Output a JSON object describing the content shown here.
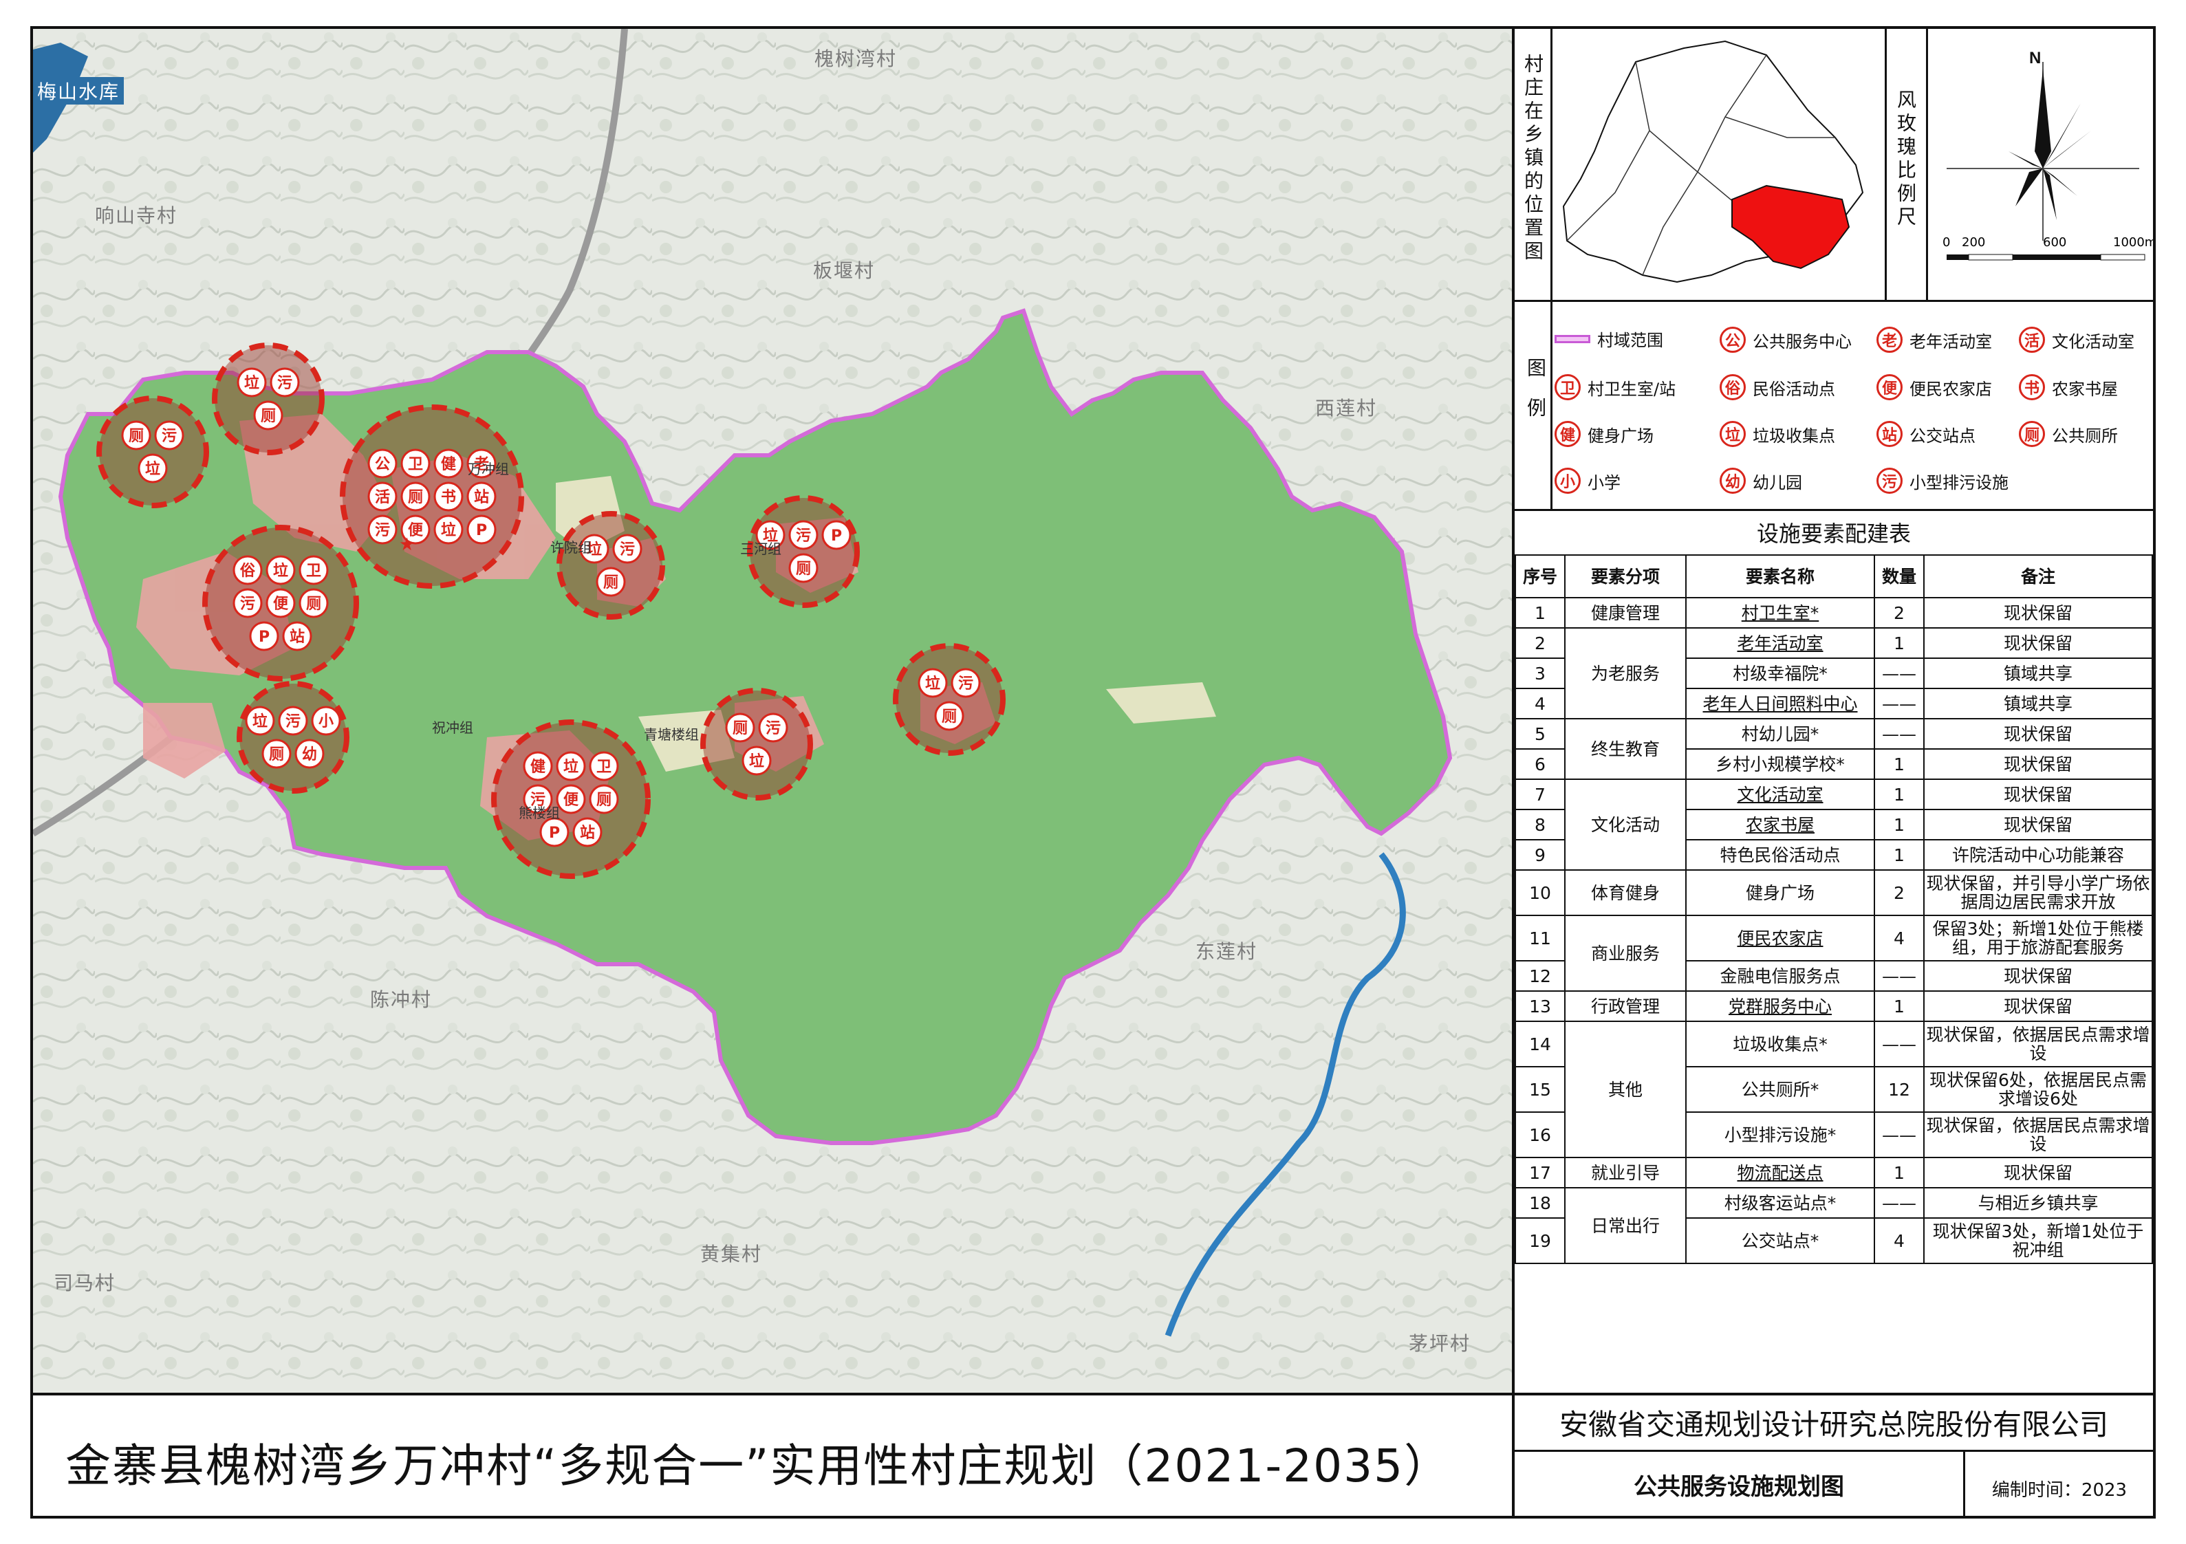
{
  "title": "金寨县槐树湾乡万冲村“多规合一”实用性村庄规划（2021-2035）",
  "company": "安徽省交通规划设计研究总院股份有限公司",
  "drawing_name": "公共服务设施规划图",
  "date_label": "编制时间：2023",
  "location_map_label": "村庄在乡镇的位置图",
  "wind_label": "风玫瑰比例尺",
  "north": "N",
  "scale": {
    "ticks": [
      "0",
      "200",
      "600",
      "1000m"
    ]
  },
  "legend_label": "图例",
  "legend": [
    {
      "icon": "",
      "label": "村域范围",
      "type": "boundary"
    },
    {
      "icon": "公",
      "label": "公共服务中心"
    },
    {
      "icon": "老",
      "label": "老年活动室"
    },
    {
      "icon": "活",
      "label": "文化活动室"
    },
    {
      "icon": "卫",
      "label": "村卫生室/站"
    },
    {
      "icon": "俗",
      "label": "民俗活动点"
    },
    {
      "icon": "便",
      "label": "便民农家店"
    },
    {
      "icon": "书",
      "label": "农家书屋"
    },
    {
      "icon": "健",
      "label": "健身广场"
    },
    {
      "icon": "垃",
      "label": "垃圾收集点"
    },
    {
      "icon": "站",
      "label": "公交站点"
    },
    {
      "icon": "厕",
      "label": "公共厕所"
    },
    {
      "icon": "小",
      "label": "小学"
    },
    {
      "icon": "幼",
      "label": "幼儿园"
    },
    {
      "icon": "污",
      "label": "小型排污设施"
    }
  ],
  "table": {
    "title": "设施要素配建表",
    "headers": [
      "序号",
      "要素分项",
      "要素名称",
      "数量",
      "备注"
    ],
    "rows": [
      {
        "no": "1",
        "cat": "健康管理",
        "name": "村卫生室*",
        "ul": true,
        "qty": "2",
        "note": "现状保留"
      },
      {
        "no": "2",
        "cat": "",
        "name": "老年活动室",
        "ul": true,
        "qty": "1",
        "note": "现状保留"
      },
      {
        "no": "3",
        "cat": "为老服务",
        "name": "村级幸福院*",
        "ul": false,
        "qty": "——",
        "note": "镇域共享"
      },
      {
        "no": "4",
        "cat": "",
        "name": "老年人日间照料中心",
        "ul": true,
        "qty": "——",
        "note": "镇域共享"
      },
      {
        "no": "5",
        "cat": "",
        "name": "村幼儿园*",
        "ul": false,
        "qty": "——",
        "note": "现状保留"
      },
      {
        "no": "6",
        "cat": "终生教育",
        "name": "乡村小规模学校*",
        "ul": false,
        "qty": "1",
        "note": "现状保留"
      },
      {
        "no": "7",
        "cat": "",
        "name": "文化活动室",
        "ul": true,
        "qty": "1",
        "note": "现状保留"
      },
      {
        "no": "8",
        "cat": "文化活动",
        "name": "农家书屋",
        "ul": true,
        "qty": "1",
        "note": "现状保留"
      },
      {
        "no": "9",
        "cat": "",
        "name": "特色民俗活动点",
        "ul": false,
        "qty": "1",
        "note": "许院活动中心功能兼容"
      },
      {
        "no": "10",
        "cat": "体育健身",
        "name": "健身广场",
        "ul": false,
        "qty": "2",
        "note": "现状保留，并引导小学广场依据周边居民需求开放"
      },
      {
        "no": "11",
        "cat": "商业服务",
        "name": "便民农家店",
        "ul": true,
        "qty": "4",
        "note": "保留3处；新增1处位于熊楼组，用于旅游配套服务"
      },
      {
        "no": "12",
        "cat": "",
        "name": "金融电信服务点",
        "ul": false,
        "qty": "——",
        "note": "现状保留"
      },
      {
        "no": "13",
        "cat": "行政管理",
        "name": "党群服务中心",
        "ul": true,
        "qty": "1",
        "note": "现状保留"
      },
      {
        "no": "14",
        "cat": "",
        "name": "垃圾收集点*",
        "ul": false,
        "qty": "——",
        "note": "现状保留，依据居民点需求增设"
      },
      {
        "no": "15",
        "cat": "其他",
        "name": "公共厕所*",
        "ul": false,
        "qty": "12",
        "note": "现状保留6处，依据居民点需求增设6处"
      },
      {
        "no": "16",
        "cat": "",
        "name": "小型排污设施*",
        "ul": false,
        "qty": "——",
        "note": "现状保留，依据居民点需求增设"
      },
      {
        "no": "17",
        "cat": "就业引导",
        "name": "物流配送点",
        "ul": true,
        "qty": "1",
        "note": "现状保留"
      },
      {
        "no": "18",
        "cat": "",
        "name": "村级客运站点*",
        "ul": false,
        "qty": "——",
        "note": "与相近乡镇共享"
      },
      {
        "no": "19",
        "cat": "日常出行",
        "name": "公交站点*",
        "ul": false,
        "qty": "4",
        "note": "现状保留3处，新增1处位于祝冲组"
      }
    ]
  },
  "villages": [
    "槐树湾村",
    "梅山水库",
    "响山寺村",
    "板堰村",
    "西莲村",
    "东莲村",
    "陈冲村",
    "黄集村",
    "司马村",
    "茅坪村"
  ],
  "groups": [
    "万冲组",
    "许院组",
    "三河组",
    "祝冲组",
    "熊楼组",
    "青塘楼组"
  ],
  "circles": [
    {
      "icons": [
        "垃",
        "污",
        "厕"
      ]
    },
    {
      "icons": [
        "厕",
        "污",
        "垃"
      ]
    },
    {
      "icons": [
        "公",
        "卫",
        "健",
        "老",
        "活",
        "厕",
        "书",
        "站",
        "污",
        "便",
        "垃",
        "P"
      ]
    },
    {
      "icons": [
        "俗",
        "垃",
        "卫",
        "污",
        "便",
        "厕",
        "P",
        "站"
      ]
    },
    {
      "icons": [
        "垃",
        "污",
        "厕"
      ]
    },
    {
      "icons": [
        "垃",
        "污",
        "P",
        "厕"
      ]
    },
    {
      "icons": [
        "垃",
        "污",
        "厕"
      ]
    },
    {
      "icons": [
        "垃",
        "污",
        "小",
        "厕",
        "幼"
      ]
    },
    {
      "icons": [
        "健",
        "垃",
        "卫",
        "污",
        "便",
        "厕",
        "P",
        "站"
      ]
    },
    {
      "icons": [
        "厕",
        "污",
        "垃"
      ]
    }
  ],
  "colors": {
    "village_fill": "#7ebf77",
    "boundary": "#d46ad9",
    "facility": "#d9261c",
    "settlement": "#e8a4a2",
    "highlight": "#ee1111"
  }
}
